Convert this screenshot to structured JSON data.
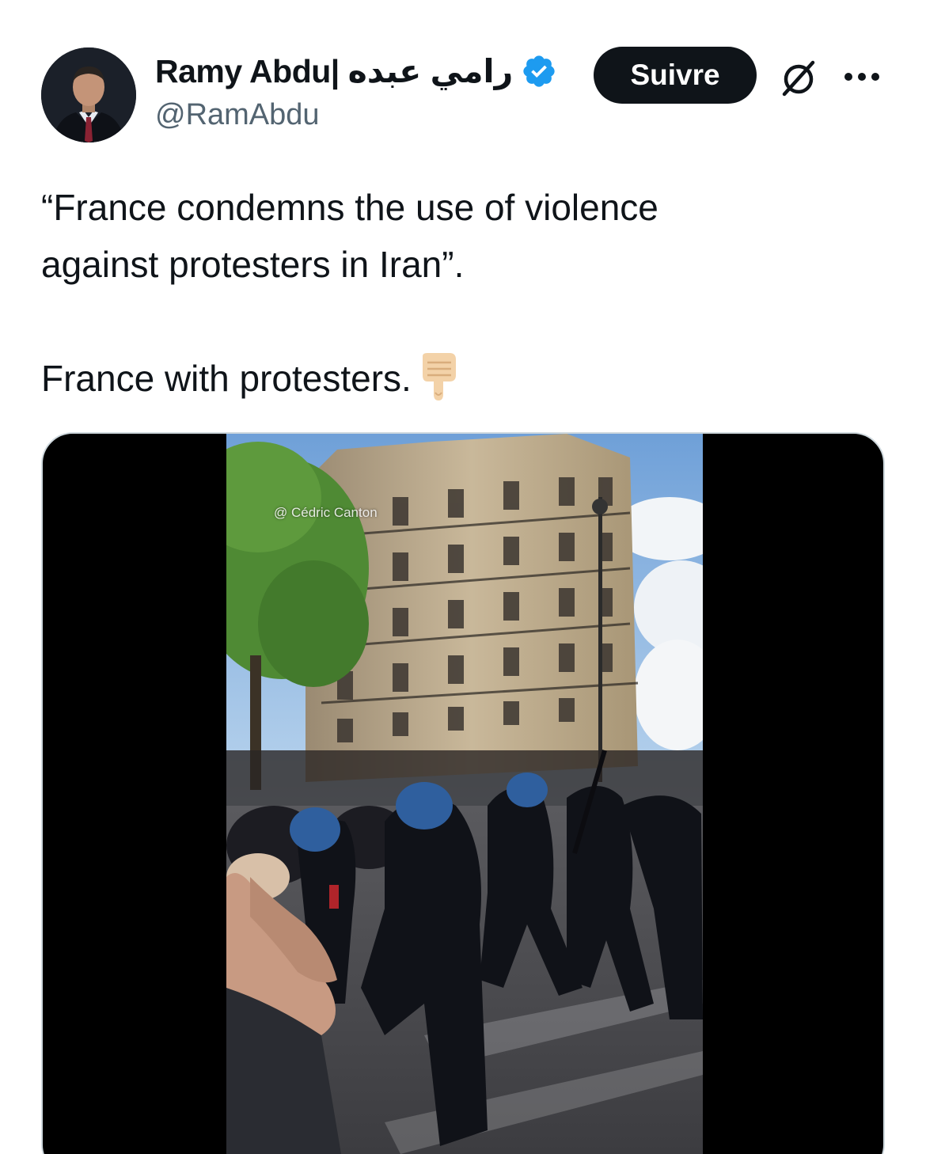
{
  "author": {
    "display_name": "Ramy Abdu| رامي عبده",
    "handle": "@RamAbdu",
    "verified": true
  },
  "actions": {
    "follow_label": "Suivre"
  },
  "icons": {
    "verified": "verified-badge-icon",
    "grok": "grok-icon",
    "more": "more-icon",
    "emoji": "backhand-index-pointing-down-emoji"
  },
  "tweet": {
    "line1": "“France condemns the use of violence",
    "line2": "against protesters in Iran”.",
    "line3": "France with protesters."
  },
  "media": {
    "watermark": "@ Cédric Canton"
  },
  "colors": {
    "verified_blue": "#1d9bf0",
    "follow_button": "#0f1419",
    "secondary_text": "#536471"
  }
}
